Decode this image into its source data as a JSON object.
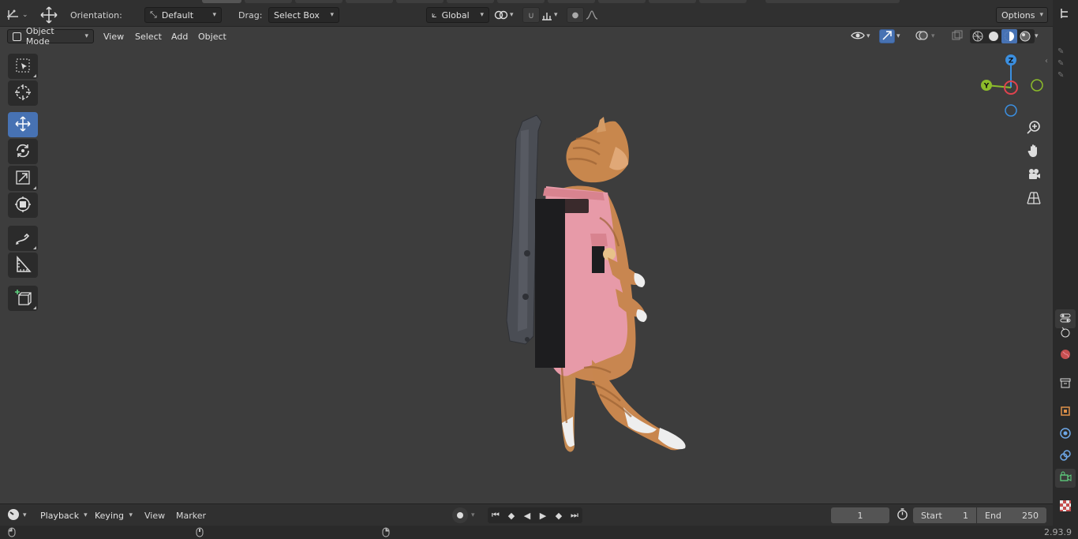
{
  "topbar": {
    "orientation_label": "Orientation:",
    "orientation_value": "Default",
    "drag_label": "Drag:",
    "drag_value": "Select Box",
    "transform_space": "Global",
    "options_label": "Options"
  },
  "header": {
    "mode": "Object Mode",
    "menus": [
      "View",
      "Select",
      "Add",
      "Object"
    ]
  },
  "gizmo": {
    "z_label": "Z",
    "y_label": "Y",
    "colors": {
      "x": "#e0434e",
      "y": "#8cbc2a",
      "z": "#3b8fe0"
    }
  },
  "toolbar": {
    "tools": [
      "select-box",
      "cursor",
      "move",
      "rotate",
      "scale",
      "transform",
      "annotate",
      "measure",
      "add-cube"
    ],
    "active": "move"
  },
  "timeline": {
    "menus": [
      "Playback",
      "Keying",
      "View",
      "Marker"
    ],
    "current_frame": "1",
    "start_label": "Start",
    "start_value": "1",
    "end_label": "End",
    "end_value": "250"
  },
  "status": {
    "version": "2.93.9"
  },
  "colors": {
    "accent": "#4772b3",
    "viewport_bg": "#3d3d3d",
    "header_bg": "#303030"
  }
}
